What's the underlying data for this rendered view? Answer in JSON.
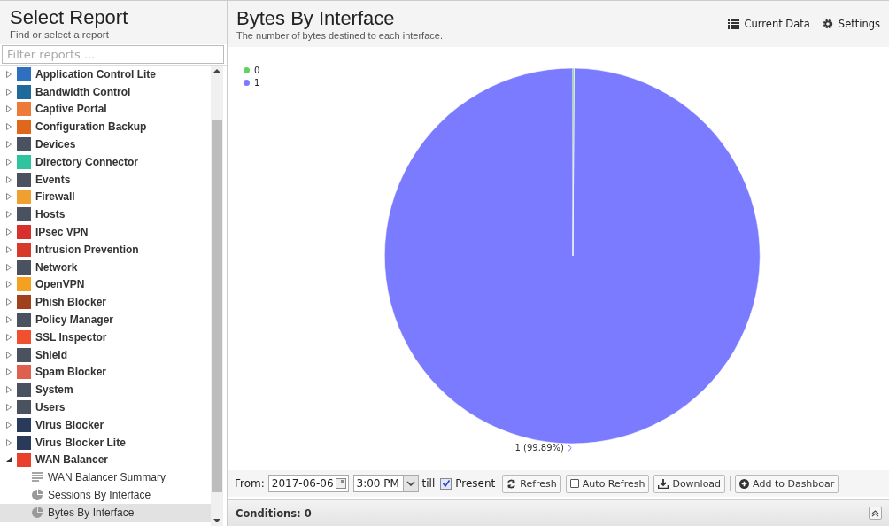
{
  "sidebar": {
    "title": "Select Report",
    "subtitle": "Find or select a report",
    "filter": {
      "placeholder": "Filter reports ..."
    },
    "items": [
      {
        "label": "Application Control Lite",
        "color": "#2f6fc0",
        "expanded": false
      },
      {
        "label": "Bandwidth Control",
        "color": "#1f6a9a",
        "expanded": false
      },
      {
        "label": "Captive Portal",
        "color": "#ee7a3a",
        "expanded": false
      },
      {
        "label": "Configuration Backup",
        "color": "#e0661c",
        "expanded": false
      },
      {
        "label": "Devices",
        "color": "#4a5260",
        "expanded": false
      },
      {
        "label": "Directory Connector",
        "color": "#2ec4a0",
        "expanded": false
      },
      {
        "label": "Events",
        "color": "#4a5260",
        "expanded": false
      },
      {
        "label": "Firewall",
        "color": "#f0a030",
        "expanded": false
      },
      {
        "label": "Hosts",
        "color": "#4a5260",
        "expanded": false
      },
      {
        "label": "IPsec VPN",
        "color": "#d8302c",
        "expanded": false
      },
      {
        "label": "Intrusion Prevention",
        "color": "#d83a2a",
        "expanded": false
      },
      {
        "label": "Network",
        "color": "#4a5260",
        "expanded": false
      },
      {
        "label": "OpenVPN",
        "color": "#f4a020",
        "expanded": false
      },
      {
        "label": "Phish Blocker",
        "color": "#a0401c",
        "expanded": false
      },
      {
        "label": "Policy Manager",
        "color": "#4a5260",
        "expanded": false
      },
      {
        "label": "SSL Inspector",
        "color": "#f05030",
        "expanded": false
      },
      {
        "label": "Shield",
        "color": "#4a5260",
        "expanded": false
      },
      {
        "label": "Spam Blocker",
        "color": "#e06050",
        "expanded": false
      },
      {
        "label": "System",
        "color": "#4a5260",
        "expanded": false
      },
      {
        "label": "Users",
        "color": "#4a5260",
        "expanded": false
      },
      {
        "label": "Virus Blocker",
        "color": "#2a3a5a",
        "expanded": false
      },
      {
        "label": "Virus Blocker Lite",
        "color": "#2a3a5a",
        "expanded": false
      },
      {
        "label": "WAN Balancer",
        "color": "#e8402a",
        "expanded": true,
        "children": [
          {
            "label": "WAN Balancer Summary",
            "kind": "text",
            "selected": false
          },
          {
            "label": "Sessions By Interface",
            "kind": "pie",
            "selected": false
          },
          {
            "label": "Bytes By Interface",
            "kind": "pie",
            "selected": true
          }
        ]
      }
    ]
  },
  "report": {
    "title": "Bytes By Interface",
    "description": "The number of bytes destined to each interface.",
    "actions": [
      {
        "label": "Current Data",
        "kind": "list"
      },
      {
        "label": "Settings",
        "kind": "gear"
      }
    ],
    "chart_data": {
      "type": "pie",
      "categories": [
        "0",
        "1"
      ],
      "values": [
        0.11,
        99.89
      ],
      "colors": [
        "#5fd35f",
        "#7b7bff"
      ],
      "legend": "top-left",
      "annotations": [
        {
          "text": "1 (99.89%)"
        }
      ]
    },
    "toolbar": {
      "from_label": "From:",
      "date": "2017-06-06",
      "time": "3:00 PM",
      "till_label": "till",
      "present": {
        "label": "Present",
        "checked": true
      },
      "buttons": [
        {
          "label": "Refresh",
          "kind": "refresh"
        },
        {
          "label": "Auto Refresh",
          "kind": "checkbox",
          "checked": false
        },
        {
          "label": "Download",
          "kind": "download"
        },
        {
          "label": "Add to Dashboar",
          "kind": "add"
        }
      ]
    },
    "conditions": {
      "label": "Conditions: 0"
    }
  }
}
